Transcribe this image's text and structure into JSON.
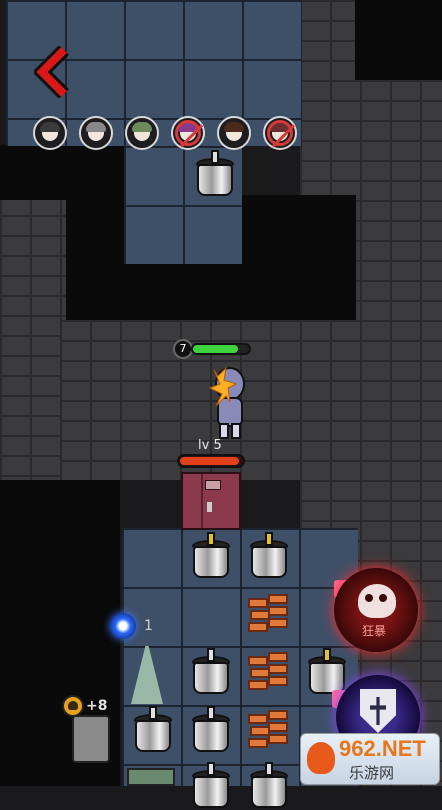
{
  "navigation": {
    "back_icon": "chevron-left-icon",
    "back_color": "#d81818"
  },
  "survivors": [
    {
      "name": "survivor-1",
      "hair": "#3a3a3a",
      "eliminated": false
    },
    {
      "name": "survivor-2",
      "hair": "#888888",
      "eliminated": false
    },
    {
      "name": "survivor-3",
      "hair": "#6a8a5a",
      "eliminated": false
    },
    {
      "name": "survivor-4",
      "hair": "#8a3a8a",
      "eliminated": true
    },
    {
      "name": "survivor-5",
      "hair": "#4a2a1a",
      "eliminated": false
    },
    {
      "name": "survivor-6",
      "hair": "#6a3030",
      "eliminated": true
    }
  ],
  "player": {
    "level": "7",
    "health_fraction": 0.8
  },
  "door": {
    "label": "lv 5",
    "health_fraction": 0.95,
    "color": "#8a3a4a"
  },
  "resources": {
    "blue_coin_count": "1",
    "skull_count": "+8"
  },
  "abilities": {
    "rage": {
      "label": "狂暴",
      "icon": "skull-icon",
      "ad_icon": "video-icon"
    },
    "shield": {
      "icon": "shield-icon",
      "ad_icon": "video-icon"
    }
  },
  "watermark": {
    "brand": "962.NET",
    "subtitle": "乐游网"
  }
}
